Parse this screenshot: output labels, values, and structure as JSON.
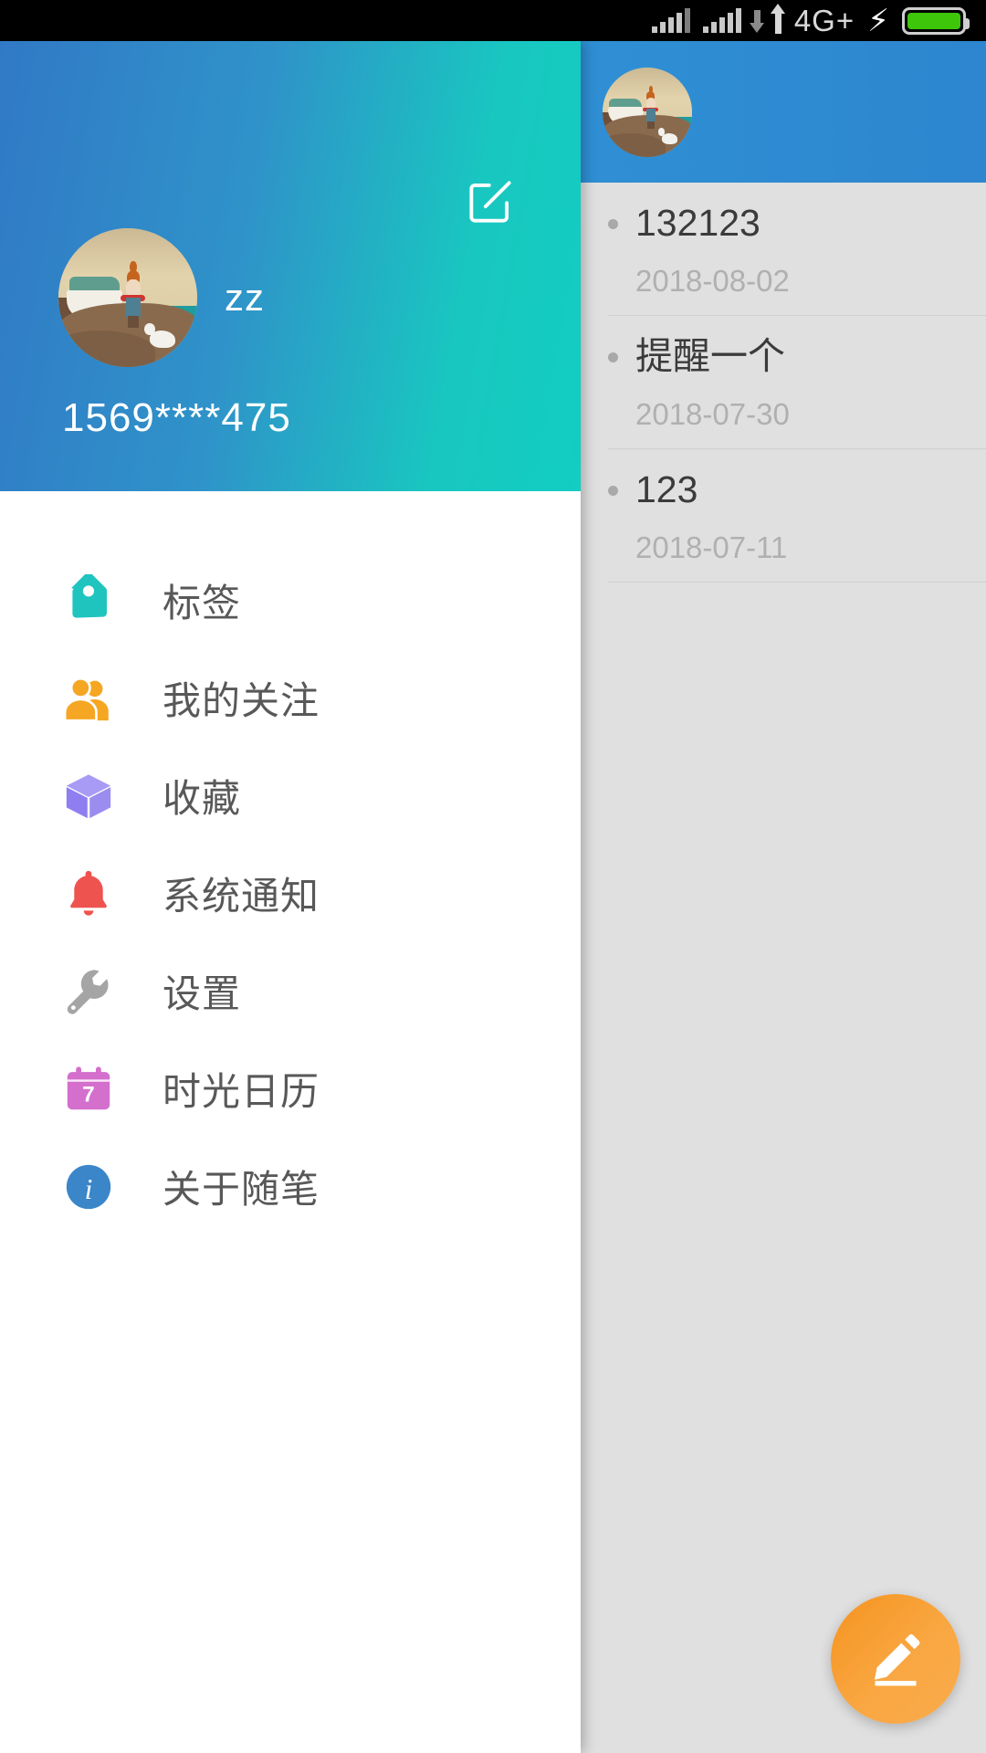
{
  "status_bar": {
    "network_label": "4G+",
    "charging_icon": "⚡",
    "signal_icon_1": "signal-bars-icon",
    "signal_icon_2": "signal-bars-icon",
    "data_transfer_icon": "data-transfer-arrows-icon",
    "battery_icon": "battery-full-icon",
    "battery_color": "#3ec60a"
  },
  "drawer": {
    "header": {
      "edit_icon": "edit-compose-icon",
      "username": "zz",
      "phone": "1569****475",
      "avatar": "user-avatar",
      "gradient_from": "#3179c6",
      "gradient_to": "#12cdc2"
    },
    "menu": [
      {
        "label": "标签",
        "icon": "tag-icon",
        "color": "#20c4bf"
      },
      {
        "label": "我的关注",
        "icon": "people-icon",
        "color": "#f5a623"
      },
      {
        "label": "收藏",
        "icon": "box-icon",
        "color": "#9b8cf0"
      },
      {
        "label": "系统通知",
        "icon": "bell-icon",
        "color": "#ef5350"
      },
      {
        "label": "设置",
        "icon": "wrench-icon",
        "color": "#a5a5a5"
      },
      {
        "label": "时光日历",
        "icon": "calendar-icon",
        "color": "#d46fce",
        "badge": "7"
      },
      {
        "label": "关于随笔",
        "icon": "info-icon",
        "color": "#3a86c8"
      }
    ]
  },
  "right_panel": {
    "avatar": "user-avatar-small",
    "notes": [
      {
        "title": "132123",
        "date": "2018-08-02"
      },
      {
        "title": "提醒一个",
        "date": "2018-07-30"
      },
      {
        "title": "123",
        "date": "2018-07-11"
      }
    ],
    "fab": {
      "icon": "pencil-write-icon",
      "color": "#f9a742"
    }
  }
}
